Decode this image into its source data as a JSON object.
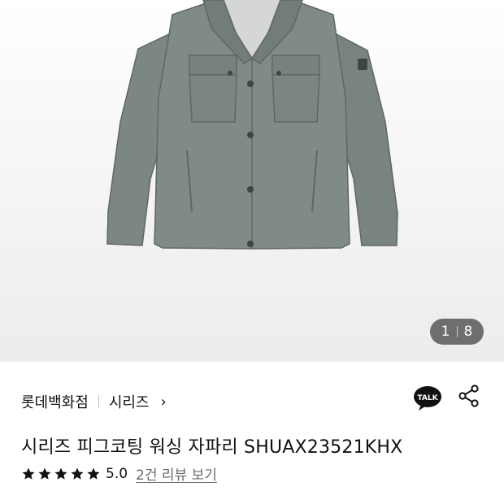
{
  "gallery": {
    "image_alt": "grey jacket product photo",
    "current": "1",
    "total": "8"
  },
  "product": {
    "brand": "롯데백화점",
    "series": "시리즈",
    "title": "시리즈 피그코팅 워싱 자파리 SHUAX23521KHX",
    "rating": {
      "stars": 5,
      "score": "5.0",
      "review_link": "2건 리뷰 보기"
    }
  },
  "actions": {
    "kakao_talk_label": "TALK",
    "share_icon": "share-icon"
  },
  "colors": {
    "star": "#111111",
    "counter_bg": "#6e6e6e",
    "jacket": "#7b8580"
  }
}
